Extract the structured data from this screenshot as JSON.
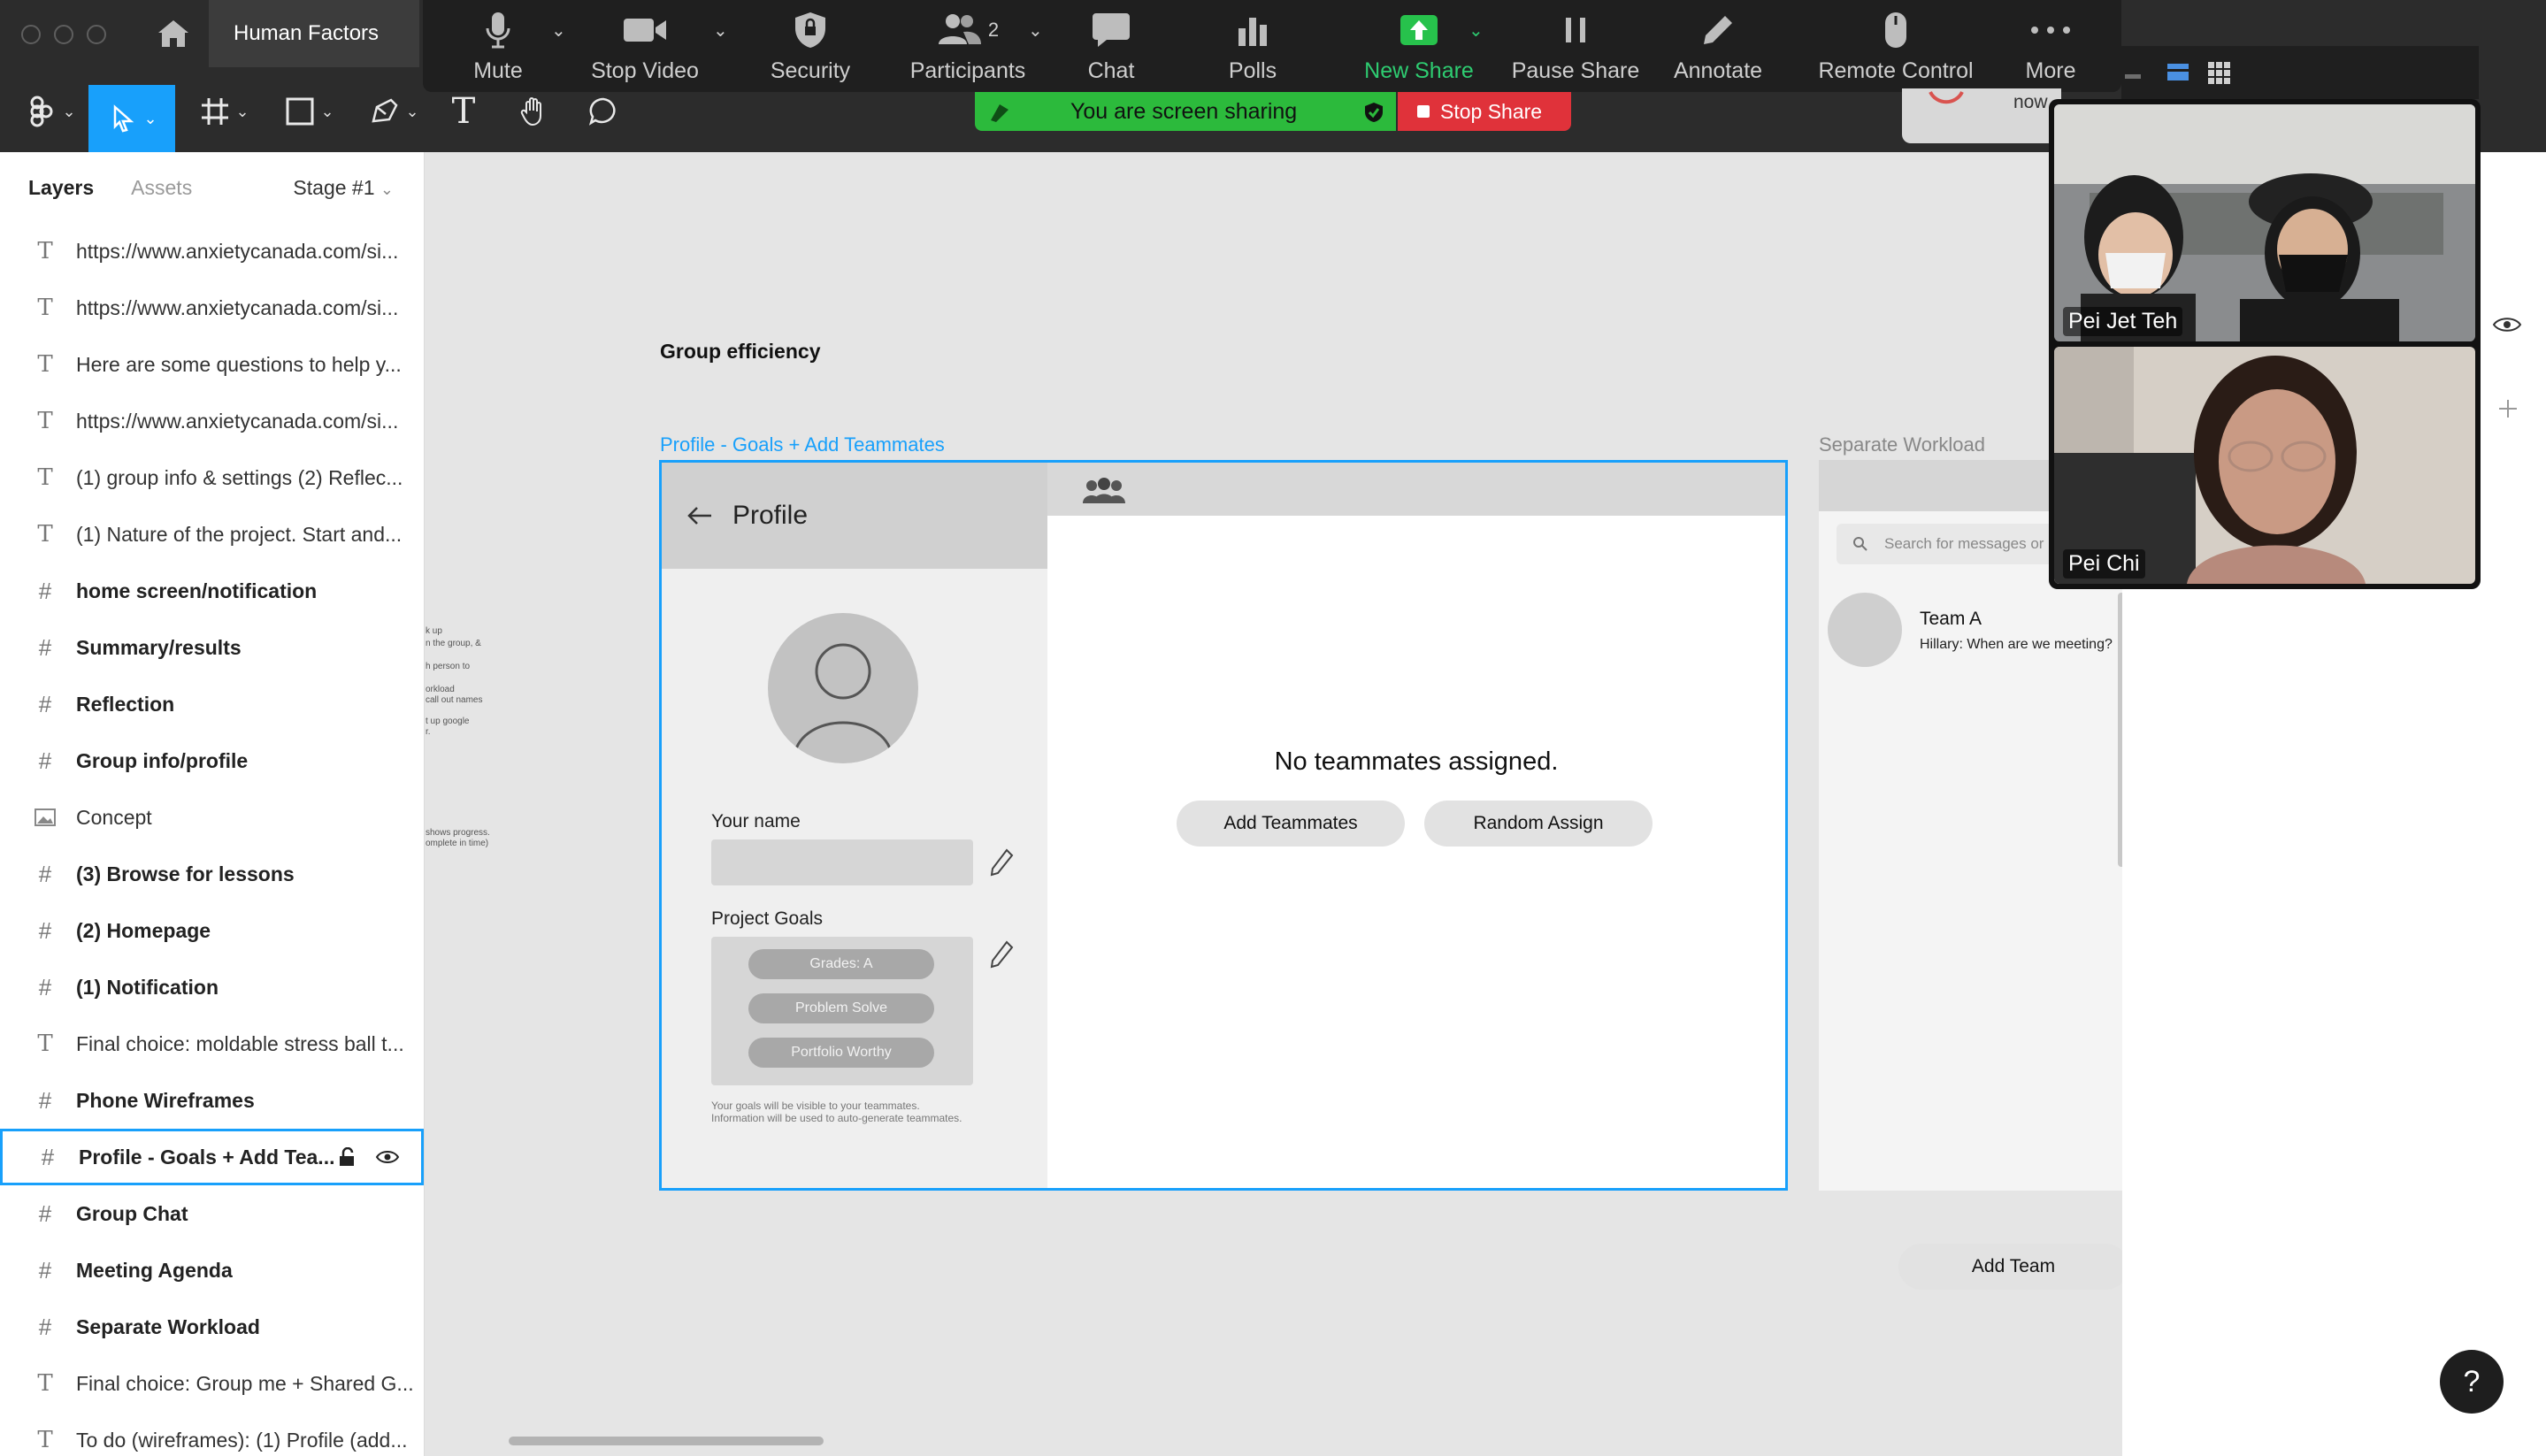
{
  "file_tab": {
    "title": "Human Factors"
  },
  "zoom_toolbar": {
    "mute": "Mute",
    "stop_video": "Stop Video",
    "security": "Security",
    "participants": "Participants",
    "participant_count": "2",
    "chat": "Chat",
    "polls": "Polls",
    "new_share": "New Share",
    "pause_share": "Pause Share",
    "annotate": "Annotate",
    "remote_control": "Remote Control",
    "more": "More"
  },
  "share_banner": {
    "text": "You are screen sharing",
    "stop": "Stop Share"
  },
  "notification": {
    "text": "now"
  },
  "layers_panel": {
    "tab_layers": "Layers",
    "tab_assets": "Assets",
    "stage": "Stage #1",
    "items": [
      {
        "type": "text",
        "label": "https://www.anxietycanada.com/si..."
      },
      {
        "type": "text",
        "label": "https://www.anxietycanada.com/si..."
      },
      {
        "type": "text",
        "label": "Here are some questions to help y..."
      },
      {
        "type": "text",
        "label": "https://www.anxietycanada.com/si..."
      },
      {
        "type": "text",
        "label": "(1) group info & settings (2) Reflec..."
      },
      {
        "type": "text",
        "label": "(1) Nature of the project. Start and..."
      },
      {
        "type": "frame",
        "label": "home screen/notification"
      },
      {
        "type": "frame",
        "label": "Summary/results"
      },
      {
        "type": "frame",
        "label": "Reflection"
      },
      {
        "type": "frame",
        "label": "Group info/profile"
      },
      {
        "type": "image",
        "label": "Concept"
      },
      {
        "type": "frame",
        "label": "(3) Browse for lessons"
      },
      {
        "type": "frame",
        "label": "(2) Homepage"
      },
      {
        "type": "frame",
        "label": "(1) Notification"
      },
      {
        "type": "text",
        "label": "Final choice: moldable stress ball t..."
      },
      {
        "type": "frame",
        "label": "Phone Wireframes"
      },
      {
        "type": "frame",
        "label": "Profile - Goals + Add Tea...",
        "selected": true
      },
      {
        "type": "frame",
        "label": "Group Chat"
      },
      {
        "type": "frame",
        "label": "Meeting Agenda"
      },
      {
        "type": "frame",
        "label": "Separate Workload"
      },
      {
        "type": "text",
        "label": "Final choice: Group me + Shared G..."
      },
      {
        "type": "text",
        "label": "To do (wireframes): (1) Profile (add..."
      }
    ]
  },
  "canvas": {
    "heading": "Group efficiency",
    "frame_label": "Profile - Goals + Add Teammates",
    "separate_label": "Separate Workload",
    "snippets": [
      "k up",
      "n the group, &",
      "h person to",
      "orkload",
      "call out names",
      "t up google",
      "r.",
      "shows progress.",
      "omplete in time)"
    ],
    "profile": {
      "title": "Profile",
      "name_label": "Your name",
      "goals_label": "Project Goals",
      "goals": [
        "Grades: A",
        "Problem Solve",
        "Portfolio Worthy"
      ],
      "note_line1": "Your goals will be visible to your teammates.",
      "note_line2": "Information will be used to auto-generate teammates.",
      "no_teammates": "No teammates assigned.",
      "add_teammates": "Add Teammates",
      "random_assign": "Random Assign"
    },
    "workload": {
      "search_placeholder": "Search for messages or",
      "team_name": "Team A",
      "last_message": "Hillary: When are we meeting?",
      "add_team": "Add Team"
    }
  },
  "video": {
    "participant1": "Pei Jet Teh",
    "participant2": "Pei Chi"
  },
  "help": "?"
}
